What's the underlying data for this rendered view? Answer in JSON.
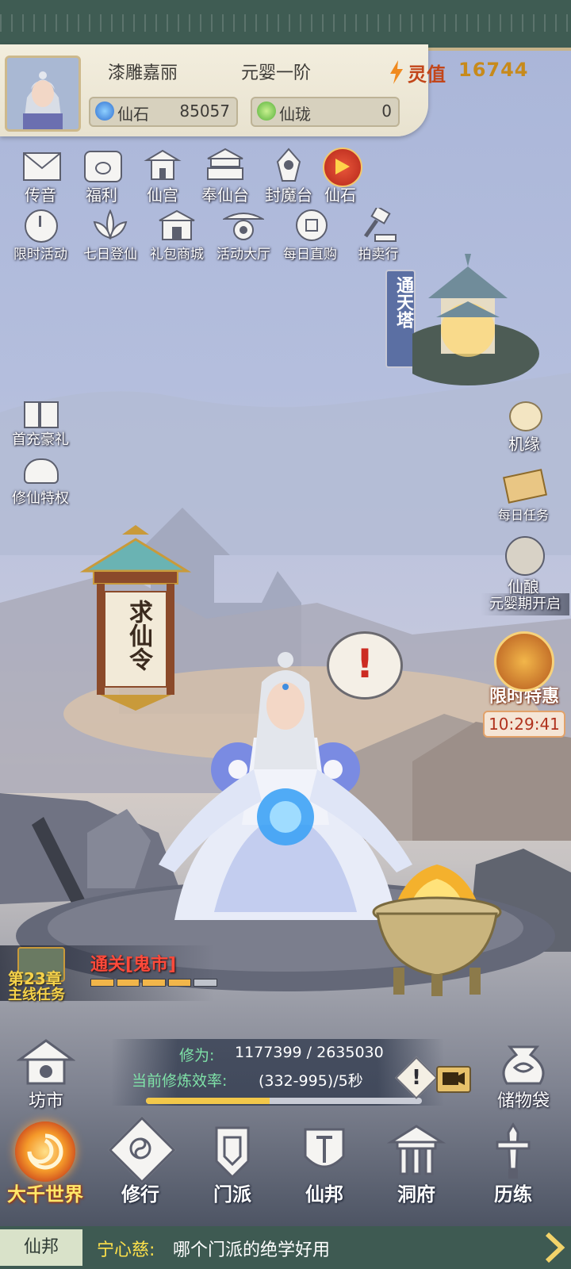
{
  "header": {
    "player_name": "漆雕嘉丽",
    "realm": "元婴一阶",
    "lingzhi_label": "灵值",
    "lingzhi_value": "16744",
    "currencies": [
      {
        "label": "仙石",
        "value": "85057",
        "icon": "blue-gem-icon",
        "color": "#2f6fd0"
      },
      {
        "label": "仙珑",
        "value": "0",
        "icon": "green-jade-icon",
        "color": "#56b13b"
      }
    ]
  },
  "top_icons_row1": [
    {
      "label": "传音",
      "icon": "envelope-icon"
    },
    {
      "label": "福利",
      "icon": "gift-chest-icon"
    },
    {
      "label": "仙宫",
      "icon": "palace-icon"
    },
    {
      "label": "奉仙台",
      "icon": "altar-icon"
    },
    {
      "label": "封魔台",
      "icon": "demon-seal-icon"
    },
    {
      "label": "仙石",
      "icon": "play-gem-icon"
    }
  ],
  "top_icons_row2": [
    {
      "label": "限时活动",
      "icon": "clock-event-icon"
    },
    {
      "label": "七日登仙",
      "icon": "lotus-icon"
    },
    {
      "label": "礼包商城",
      "icon": "shop-icon"
    },
    {
      "label": "活动大厅",
      "icon": "hall-icon"
    },
    {
      "label": "每日直购",
      "icon": "coin-icon"
    },
    {
      "label": "拍卖行",
      "icon": "auction-hammer-icon"
    }
  ],
  "tower": {
    "label": "通天塔"
  },
  "left_side": [
    {
      "label": "首充豪礼",
      "icon": "first-charge-gift-icon"
    },
    {
      "label": "修仙特权",
      "icon": "turtle-icon"
    }
  ],
  "right_side": [
    {
      "label": "机缘",
      "icon": "fortune-cat-icon"
    },
    {
      "label": "每日任务",
      "icon": "scroll-icon"
    },
    {
      "label": "仙酿",
      "icon": "wine-jar-icon"
    },
    {
      "label": "元婴期开启"
    },
    {
      "label": "限时特惠",
      "timer": "10:29:41",
      "icon": "limited-offer-icon"
    }
  ],
  "lantern": {
    "text": "求仙令"
  },
  "alert_bubble": {
    "text": "!"
  },
  "main_task": {
    "chapter": "第23章",
    "title": "主线任务",
    "goal": "通关[鬼市]",
    "progress": 0.8
  },
  "cultivation": {
    "label": "修为:",
    "value": "1177399 / 2635030",
    "progress": 0.447,
    "efficiency_label": "当前修炼效率:",
    "efficiency_value": "(332-995)/5秒"
  },
  "side_buttons": [
    {
      "label": "坊市",
      "icon": "market-icon"
    },
    {
      "label": "储物袋",
      "icon": "storage-bag-icon"
    }
  ],
  "bottom_nav": [
    {
      "label": "大千世界",
      "icon": "world-swirl-icon",
      "active": true
    },
    {
      "label": "修行",
      "icon": "cultivate-icon"
    },
    {
      "label": "门派",
      "icon": "sect-icon"
    },
    {
      "label": "仙邦",
      "icon": "alliance-icon"
    },
    {
      "label": "洞府",
      "icon": "cave-house-icon"
    },
    {
      "label": "历练",
      "icon": "sword-trial-icon"
    }
  ],
  "chat": {
    "channel": "仙邦",
    "sender": "宁心慈:",
    "message": "哪个门派的绝学好用"
  }
}
